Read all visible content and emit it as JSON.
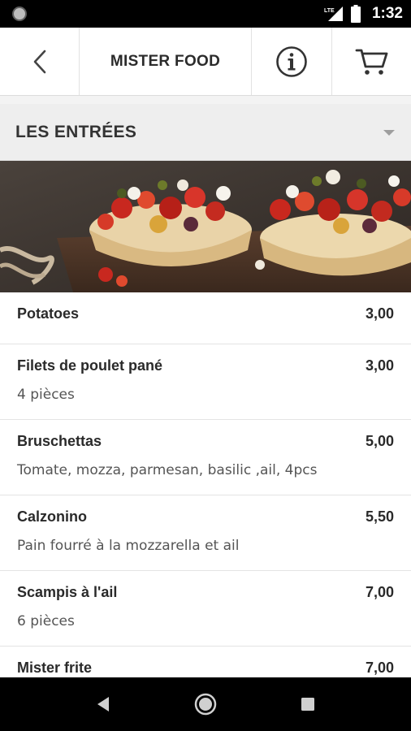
{
  "status_bar": {
    "network": "LTE",
    "time": "1:32"
  },
  "app_bar": {
    "title": "MISTER FOOD",
    "back_icon": "chevron-left-icon",
    "info_icon": "info-icon",
    "cart_icon": "cart-icon"
  },
  "category": {
    "selected": "LES ENTRÉES"
  },
  "banner": {
    "image": "bruschetta-photo"
  },
  "menu": {
    "items": [
      {
        "name": "Potatoes",
        "price": "3,00",
        "description": ""
      },
      {
        "name": "Filets de poulet pané",
        "price": "3,00",
        "description": "4 pièces"
      },
      {
        "name": "Bruschettas",
        "price": "5,00",
        "description": "Tomate, mozza, parmesan, basilic ,ail, 4pcs"
      },
      {
        "name": "Calzonino",
        "price": "5,50",
        "description": "Pain fourré à la mozzarella et ail"
      },
      {
        "name": "Scampis à l'ail",
        "price": "7,00",
        "description": "6 pièces"
      },
      {
        "name": "Mister frite",
        "price": "7,00",
        "description": ""
      }
    ]
  },
  "colors": {
    "header_bg": "#ffffff",
    "category_bg": "#eeeeee",
    "nav_bg": "#000000"
  }
}
